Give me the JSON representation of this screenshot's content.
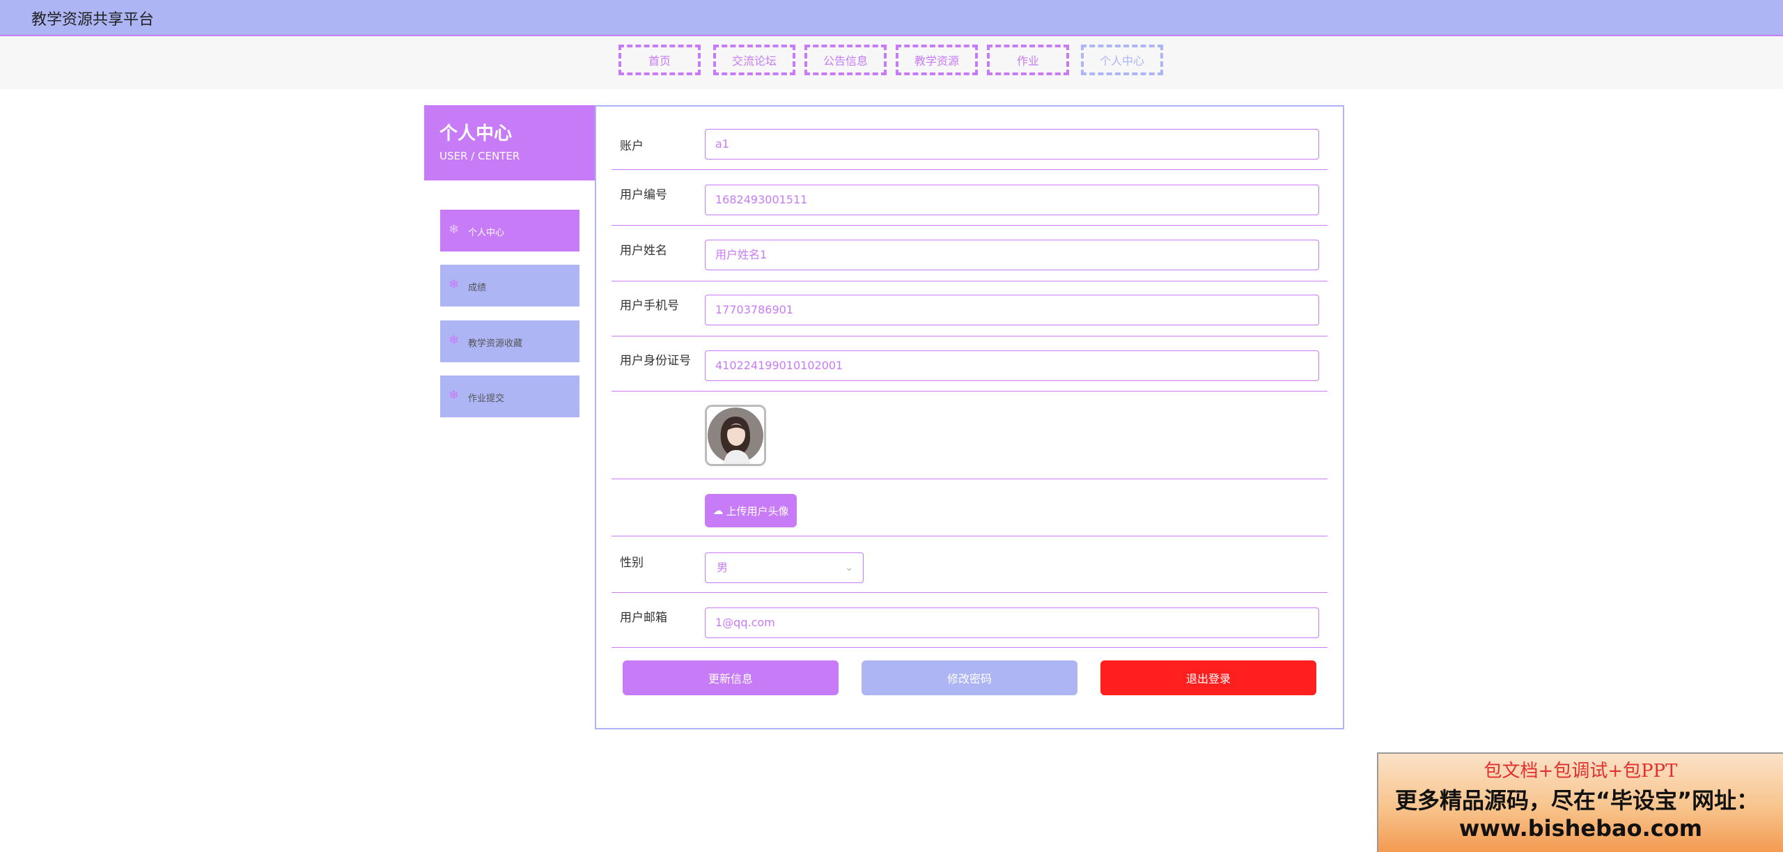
{
  "app": {
    "title": "教学资源共享平台"
  },
  "nav": {
    "items": [
      {
        "label": "首页"
      },
      {
        "label": "交流论坛"
      },
      {
        "label": "公告信息"
      },
      {
        "label": "教学资源"
      },
      {
        "label": "作业"
      },
      {
        "label": "个人中心"
      }
    ],
    "active": "个人中心"
  },
  "sidebar": {
    "title": "个人中心",
    "subtitle": "USER / CENTER",
    "items": [
      {
        "label": "个人中心",
        "active": true
      },
      {
        "label": "成绩"
      },
      {
        "label": "教学资源收藏"
      },
      {
        "label": "作业提交"
      }
    ]
  },
  "form": {
    "account": {
      "label": "账户",
      "value": "a1"
    },
    "user_no": {
      "label": "用户编号",
      "value": "1682493001511"
    },
    "user_name": {
      "label": "用户姓名",
      "value": "用户姓名1"
    },
    "phone": {
      "label": "用户手机号",
      "value": "17703786901"
    },
    "id_card": {
      "label": "用户身份证号",
      "value": "410224199010102001"
    },
    "upload_label": "上传用户头像",
    "gender": {
      "label": "性别",
      "value": "男"
    },
    "email": {
      "label": "用户邮箱",
      "value": "1@qq.com"
    }
  },
  "actions": {
    "update": "更新信息",
    "change_password": "修改密码",
    "logout": "退出登录"
  },
  "banner": {
    "line1": "包文档+包调试+包PPT",
    "line2": "更多精品源码，尽在“毕设宝”网址：",
    "line3": "www.bishebao.com"
  },
  "colors": {
    "primary": "#c87bf7",
    "secondary": "#adb5f5",
    "danger": "#ff1f1f"
  }
}
